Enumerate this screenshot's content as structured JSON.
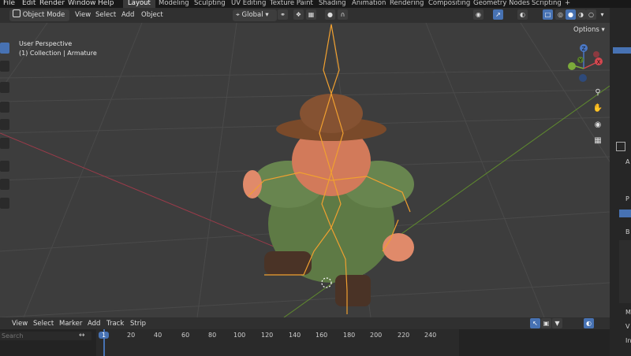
{
  "menu": [
    "File",
    "Edit",
    "Render",
    "Window",
    "Help"
  ],
  "workspaces": [
    "Layout",
    "Modeling",
    "Sculpting",
    "UV Editing",
    "Texture Paint",
    "Shading",
    "Animation",
    "Rendering",
    "Compositing",
    "Geometry Nodes",
    "Scripting"
  ],
  "active_workspace": "Layout",
  "add_workspace": "+",
  "header": {
    "mode": "Object Mode",
    "menus": [
      "View",
      "Select",
      "Add",
      "Object"
    ],
    "orientation": "Global",
    "options": "Options"
  },
  "viewport": {
    "line1": "User Perspective",
    "line2": "(1) Collection | Armature"
  },
  "gizmo": {
    "x": "X",
    "y": "Y",
    "z": "Z"
  },
  "timeline": {
    "menus": [
      "View",
      "Select",
      "Marker",
      "Add",
      "Track",
      "Strip"
    ],
    "search_placeholder": "Search",
    "current_frame": "1",
    "ticks": [
      "20",
      "40",
      "60",
      "80",
      "100",
      "120",
      "140",
      "160",
      "180",
      "200",
      "220",
      "240"
    ]
  },
  "right_panel": [
    "A",
    "P",
    "B",
    "M",
    "V",
    "In"
  ]
}
